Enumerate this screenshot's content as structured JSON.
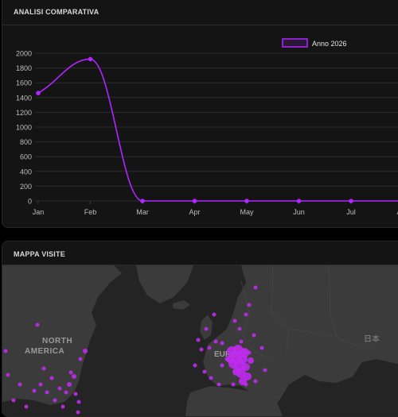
{
  "chart_card": {
    "title": "ANALISI COMPARATIVA"
  },
  "map_card": {
    "title": "MAPPA VISITE"
  },
  "chart_data": {
    "type": "line",
    "categories": [
      "Jan",
      "Feb",
      "Mar",
      "Apr",
      "May",
      "Jun",
      "Jul",
      "Aug"
    ],
    "series": [
      {
        "name": "Anno 2026",
        "values": [
          1460,
          1920,
          0,
          0,
          0,
          0,
          0,
          0
        ],
        "color": "#b026ff"
      }
    ],
    "yticks": [
      0,
      200,
      400,
      600,
      800,
      1000,
      1200,
      1400,
      1600,
      1800,
      2000
    ],
    "ylim": [
      0,
      2000
    ],
    "grid": true,
    "legend_position": "top-right"
  },
  "map": {
    "labels": {
      "north_america": "NORTH AMERICA",
      "europe": "EUROPE",
      "japan": "日本"
    },
    "dot_color": "#c02bf0",
    "land_color": "#3a3a3a",
    "sea_color": "#242424"
  }
}
